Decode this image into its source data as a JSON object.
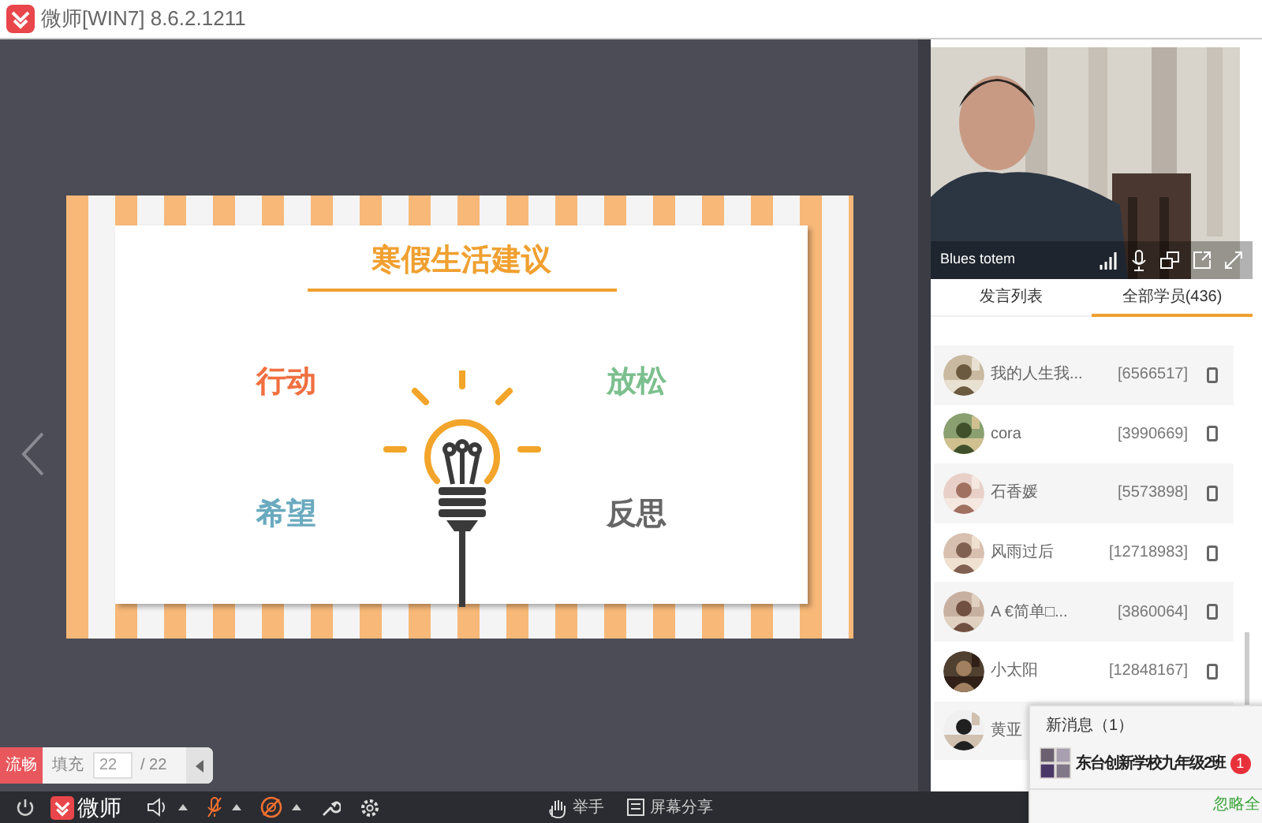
{
  "window": {
    "title": "微师[WIN7] 8.6.2.1211"
  },
  "slide": {
    "title": "寒假生活建议",
    "words": [
      {
        "text": "行动",
        "color": "#f07040"
      },
      {
        "text": "放松",
        "color": "#7cbf8e"
      },
      {
        "text": "希望",
        "color": "#6aaabf"
      },
      {
        "text": "反思",
        "color": "#666666"
      }
    ]
  },
  "video": {
    "kind": "picture",
    "name": "Blues totem"
  },
  "tabs": [
    {
      "label": "发言列表",
      "selected": false
    },
    {
      "label": "全部学员(436)",
      "selected": true
    }
  ],
  "students": [
    {
      "name": "我的人生我...",
      "id": "[6566517]"
    },
    {
      "name": "cora",
      "id": "[3990669]"
    },
    {
      "name": "石香媛",
      "id": "[5573898]"
    },
    {
      "name": "风雨过后",
      "id": "[12718983]"
    },
    {
      "name": "A €简单□...",
      "id": "[3860064]"
    },
    {
      "name": "小太阳",
      "id": "[12848167]"
    },
    {
      "name": "黄亚"
    }
  ],
  "page_control": {
    "quality": "流畅",
    "mode": "填充",
    "page": "22",
    "total": "/ 22"
  },
  "toolbar": {
    "logo": "微师",
    "mic_on": false,
    "camera_on": false,
    "buttons": [
      {
        "kind": "hand",
        "label": "举手"
      },
      {
        "kind": "share",
        "label": "屏幕分享"
      }
    ]
  },
  "notification": {
    "title": "新消息（1）",
    "group": "东台创新学校九年级2班",
    "badge": "1",
    "action": "忽略全"
  }
}
